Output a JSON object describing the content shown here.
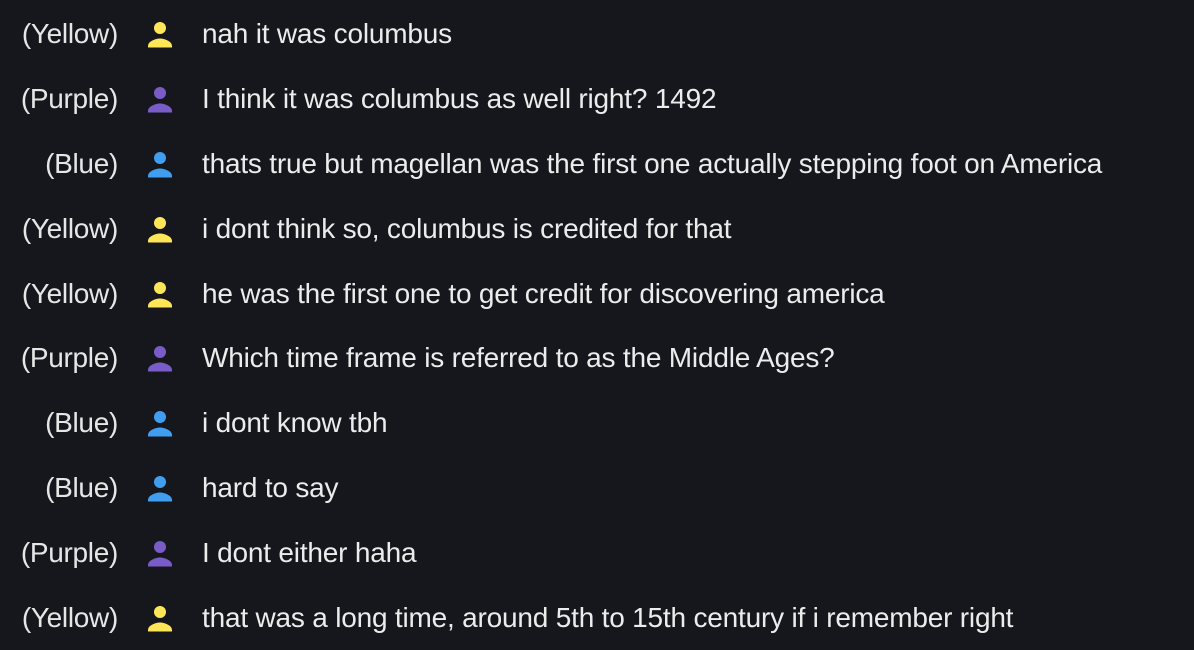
{
  "colors": {
    "background": "#15171c",
    "Yellow": "#ffe658",
    "Purple": "#7a5cc9",
    "Blue": "#3f9ef0"
  },
  "messages": [
    {
      "speaker": "(Yellow)",
      "color": "Yellow",
      "icon": "person-icon",
      "text": "nah it was columbus"
    },
    {
      "speaker": "(Purple)",
      "color": "Purple",
      "icon": "person-icon",
      "text": "I think it was columbus as well right? 1492"
    },
    {
      "speaker": "(Blue)",
      "color": "Blue",
      "icon": "person-icon",
      "text": "thats true but magellan was the first one actually stepping foot on America"
    },
    {
      "speaker": "(Yellow)",
      "color": "Yellow",
      "icon": "person-icon",
      "text": "i dont think so, columbus is credited for that"
    },
    {
      "speaker": "(Yellow)",
      "color": "Yellow",
      "icon": "person-icon",
      "text": "he was the first one to get credit for discovering america"
    },
    {
      "speaker": "(Purple)",
      "color": "Purple",
      "icon": "person-icon",
      "text": "Which time frame is referred to as the Middle Ages?"
    },
    {
      "speaker": "(Blue)",
      "color": "Blue",
      "icon": "person-icon",
      "text": "i dont know tbh"
    },
    {
      "speaker": "(Blue)",
      "color": "Blue",
      "icon": "person-icon",
      "text": "hard to say"
    },
    {
      "speaker": "(Purple)",
      "color": "Purple",
      "icon": "person-icon",
      "text": "I dont either haha"
    },
    {
      "speaker": "(Yellow)",
      "color": "Yellow",
      "icon": "person-icon",
      "text": "that was a long time, around 5th to 15th century if i remember right"
    }
  ]
}
